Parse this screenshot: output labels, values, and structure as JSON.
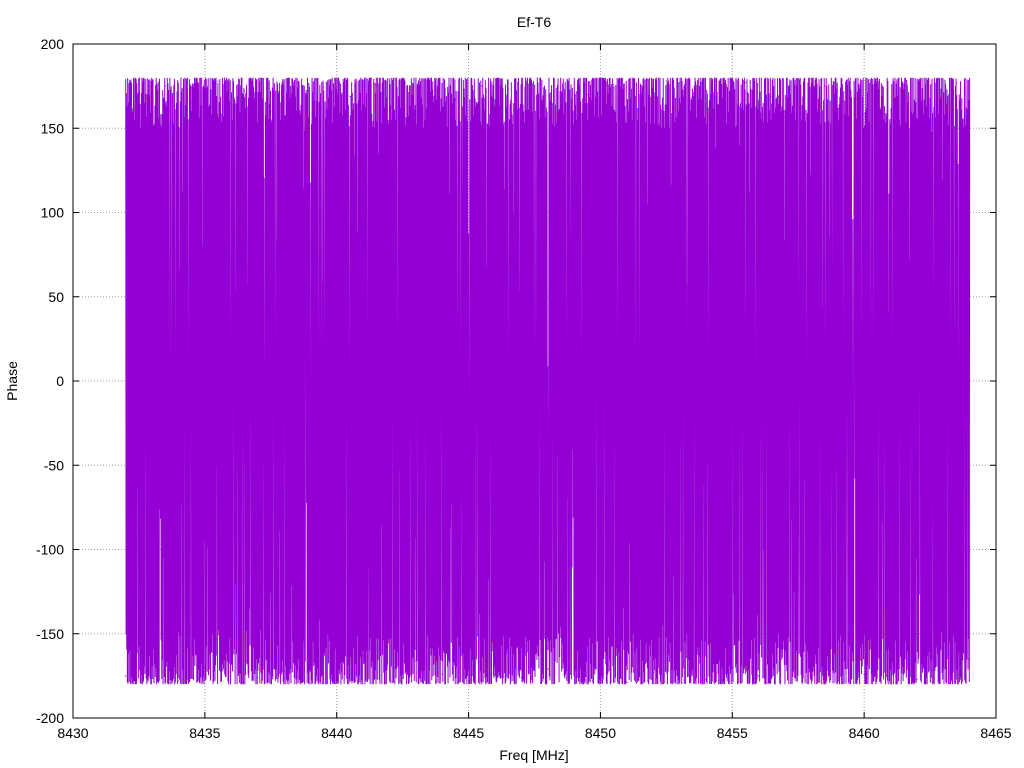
{
  "chart_data": {
    "type": "line",
    "title": "Ef-T6",
    "xlabel": "Freq [MHz]",
    "ylabel": "Phase",
    "xlim": [
      8430,
      8465
    ],
    "ylim": [
      -200,
      200
    ],
    "xticks": [
      8430,
      8435,
      8440,
      8445,
      8450,
      8455,
      8460,
      8465
    ],
    "yticks": [
      -200,
      -150,
      -100,
      -50,
      0,
      50,
      100,
      150,
      200
    ],
    "grid": true,
    "series": [
      {
        "color": "#9400d3",
        "x_range": [
          8432,
          8464
        ],
        "description": "dense wrapped phase noise spanning approximately -180 to 180",
        "y_min": -180,
        "y_max": 180,
        "sampled_points": [
          [
            8432.0,
            -175
          ],
          [
            8432.5,
            170
          ],
          [
            8433.0,
            -160
          ],
          [
            8433.5,
            175
          ],
          [
            8434.0,
            -178
          ],
          [
            8434.5,
            165
          ],
          [
            8435.0,
            -170
          ],
          [
            8435.5,
            178
          ],
          [
            8436.0,
            -165
          ],
          [
            8436.5,
            172
          ],
          [
            8437.0,
            -176
          ],
          [
            8437.5,
            160
          ],
          [
            8438.0,
            -172
          ],
          [
            8438.5,
            177
          ],
          [
            8439.0,
            -168
          ],
          [
            8439.5,
            174
          ],
          [
            8440.0,
            -179
          ],
          [
            8440.5,
            169
          ],
          [
            8441.0,
            -163
          ],
          [
            8441.5,
            176
          ],
          [
            8442.0,
            -177
          ],
          [
            8442.5,
            171
          ],
          [
            8443.0,
            -166
          ],
          [
            8443.5,
            178
          ],
          [
            8444.0,
            -174
          ],
          [
            8444.5,
            167
          ],
          [
            8445.0,
            -178
          ],
          [
            8445.5,
            175
          ],
          [
            8446.0,
            -169
          ],
          [
            8446.5,
            173
          ],
          [
            8447.0,
            -176
          ],
          [
            8447.5,
            168
          ],
          [
            8448.0,
            -171
          ],
          [
            8448.5,
            177
          ],
          [
            8449.0,
            -175
          ],
          [
            8449.5,
            170
          ],
          [
            8450.0,
            -167
          ],
          [
            8450.5,
            176
          ],
          [
            8451.0,
            -179
          ],
          [
            8451.5,
            172
          ],
          [
            8452.0,
            -173
          ],
          [
            8452.5,
            178
          ],
          [
            8453.0,
            -168
          ],
          [
            8453.5,
            166
          ],
          [
            8454.0,
            -177
          ],
          [
            8454.5,
            174
          ],
          [
            8455.0,
            -170
          ],
          [
            8455.5,
            177
          ],
          [
            8456.0,
            -175
          ],
          [
            8456.5,
            169
          ],
          [
            8457.0,
            -172
          ],
          [
            8457.5,
            178
          ],
          [
            8458.0,
            -166
          ],
          [
            8458.5,
            175
          ],
          [
            8459.0,
            -178
          ],
          [
            8459.5,
            171
          ],
          [
            8460.0,
            -174
          ],
          [
            8460.5,
            176
          ],
          [
            8461.0,
            -169
          ],
          [
            8461.5,
            173
          ],
          [
            8462.0,
            -177
          ],
          [
            8462.5,
            168
          ],
          [
            8463.0,
            -171
          ],
          [
            8463.5,
            177
          ],
          [
            8464.0,
            -165
          ]
        ]
      }
    ]
  }
}
